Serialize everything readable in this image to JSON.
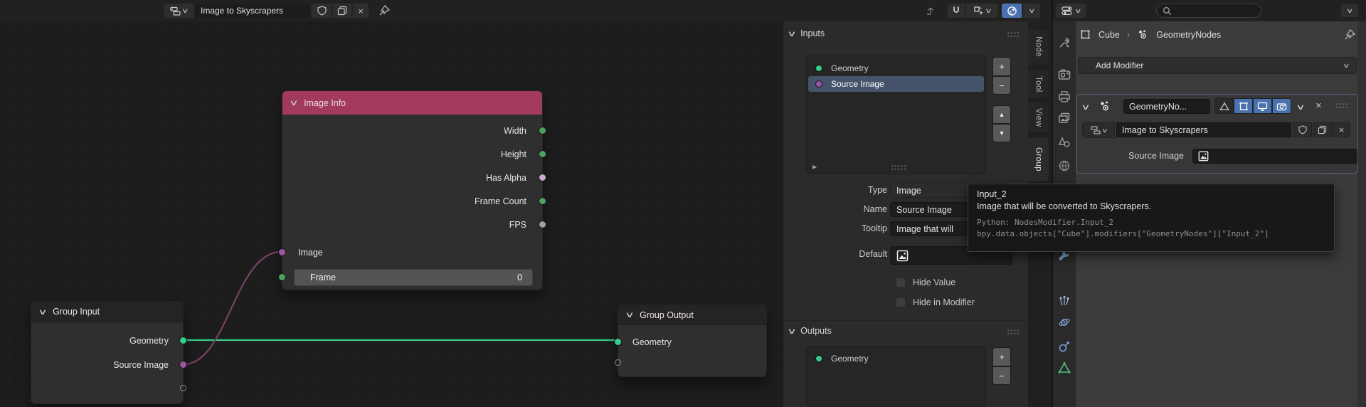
{
  "colors": {
    "node_header_pink": "#a23a5e",
    "socket_int": "#4fa15f",
    "socket_bool": "#cca6d6",
    "socket_float": "#a1a1a1",
    "socket_image": "#9c56a6",
    "socket_geometry": "#36cc8c",
    "wire_geometry": "#36cc8c",
    "wire_image": "#7a4168",
    "active_blue": "#4b72b0",
    "selection_row": "#47536a",
    "object_orange": "#e8890d"
  },
  "editor_header": {
    "tree_name": "Image to Skyscrapers"
  },
  "nodes": {
    "image_info": {
      "title": "Image Info",
      "outputs": [
        {
          "label": "Width"
        },
        {
          "label": "Height"
        },
        {
          "label": "Has Alpha"
        },
        {
          "label": "Frame Count"
        },
        {
          "label": "FPS"
        }
      ],
      "input_image_label": "Image",
      "frame_label": "Frame",
      "frame_value": "0"
    },
    "group_input": {
      "title": "Group Input",
      "outputs": [
        {
          "label": "Geometry"
        },
        {
          "label": "Source Image"
        }
      ]
    },
    "group_output": {
      "title": "Group Output",
      "inputs": [
        {
          "label": "Geometry"
        }
      ]
    }
  },
  "sidebar": {
    "tabs": [
      {
        "label": "Node"
      },
      {
        "label": "Tool"
      },
      {
        "label": "View"
      },
      {
        "label": "Group"
      }
    ],
    "inputs_panel": {
      "title": "Inputs",
      "items": [
        {
          "label": "Geometry"
        },
        {
          "label": "Source Image"
        }
      ],
      "add": "+",
      "remove": "−",
      "up": "▲",
      "down": "▼",
      "expand_arrow": "▶",
      "fields": {
        "type_label": "Type",
        "type_value": "Image",
        "name_label": "Name",
        "name_value": "Source Image",
        "tooltip_label": "Tooltip",
        "tooltip_value": "Image that will",
        "default_label": "Default",
        "hide_value_label": "Hide Value",
        "hide_in_modifier_label": "Hide in Modifier"
      }
    },
    "outputs_panel": {
      "title": "Outputs",
      "items": [
        {
          "label": "Geometry"
        }
      ],
      "add": "+",
      "remove": "−"
    }
  },
  "tooltip": {
    "title": "Input_2",
    "description": "Image that will be converted to Skyscrapers.",
    "python_line": "Python: NodesModifier.Input_2",
    "path_line": "bpy.data.objects[\"Cube\"].modifiers[\"GeometryNodes\"][\"Input_2\"]"
  },
  "properties": {
    "breadcrumb": {
      "object": "Cube",
      "separator": "›",
      "datablock": "GeometryNodes"
    },
    "add_modifier_label": "Add Modifier",
    "modifier": {
      "name": "GeometryNo...",
      "tree_name": "Image to Skyscrapers",
      "source_image_label": "Source Image"
    }
  },
  "glyphs": {
    "chevron_down": "∨",
    "close": "×"
  }
}
